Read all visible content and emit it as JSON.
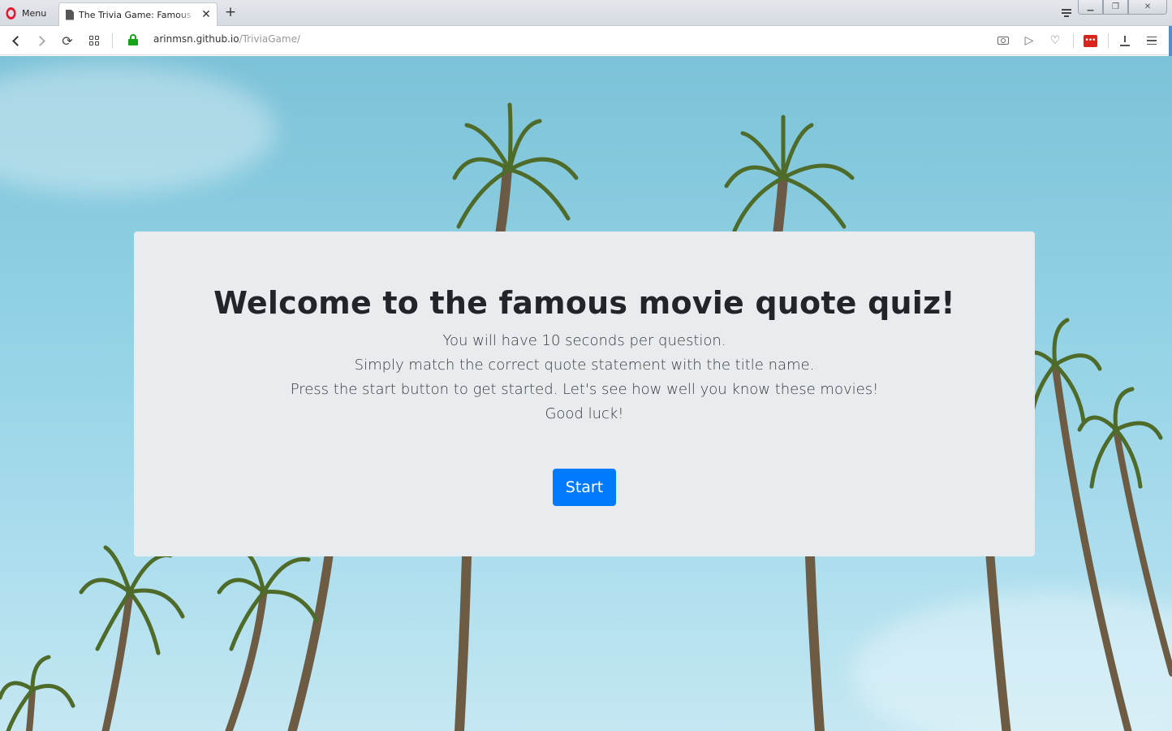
{
  "browser": {
    "menu_label": "Menu",
    "tab_title": "The Trivia Game: Famous Movie Quotes",
    "tab_close": "✕",
    "new_tab": "+",
    "url_host": "arinmsn.github.io",
    "url_path": "/TriviaGame/",
    "extension_badge": "•••"
  },
  "jumbotron": {
    "heading": "Welcome to the famous movie quote quiz!",
    "lines": [
      "You will have 10 seconds per question.",
      "Simply match the correct quote statement with the title name.",
      "Press the start button to get started. Let's see how well you know these movies!",
      "Good luck!"
    ],
    "start_label": "Start"
  },
  "colors": {
    "primary": "#007bff",
    "jumbotron_bg": "#e9ecef",
    "secure_lock": "#17a317",
    "opera_red": "#e8172c"
  }
}
